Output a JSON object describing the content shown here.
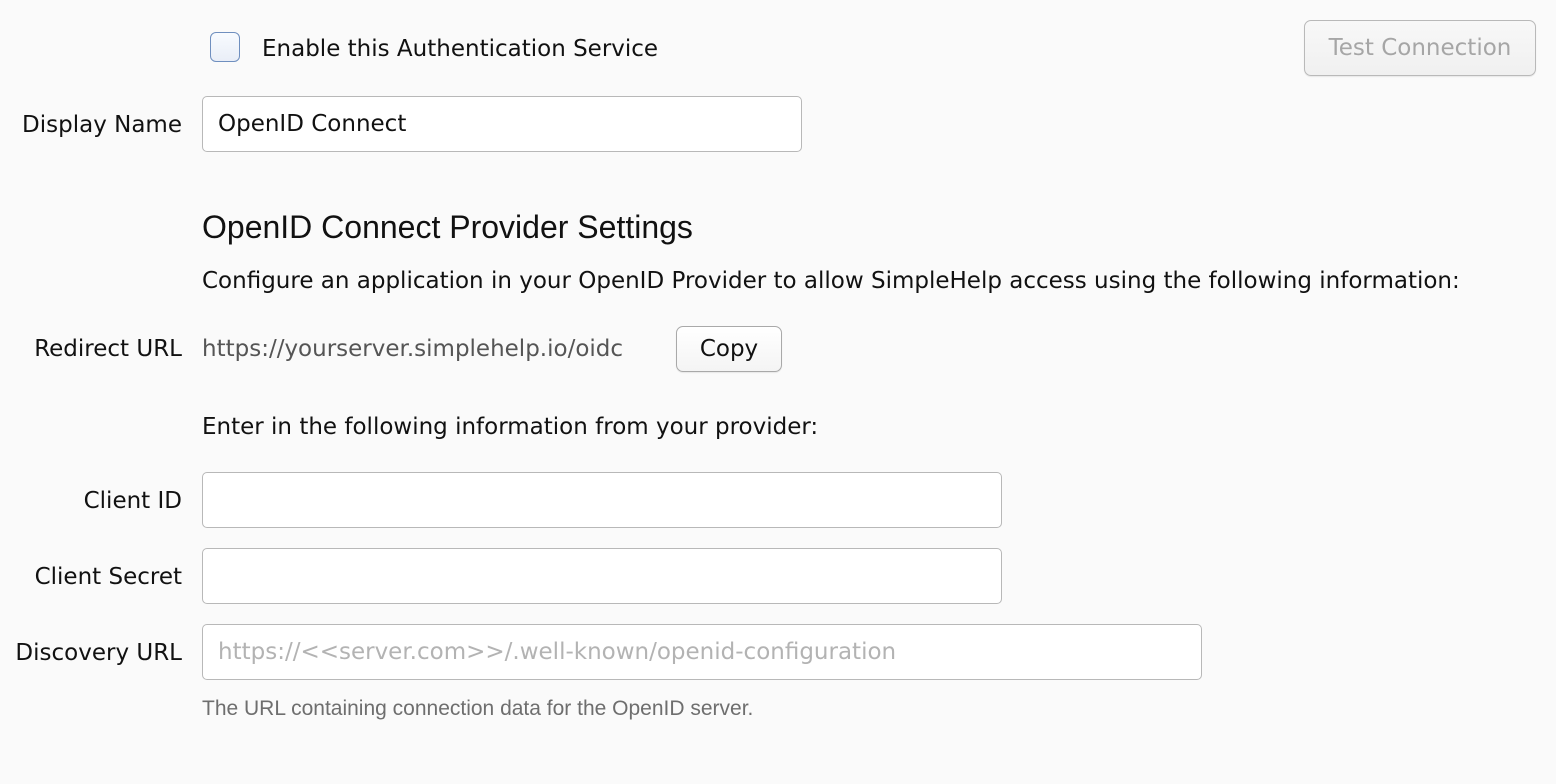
{
  "enable_service": {
    "label": "Enable this Authentication Service",
    "checked": false
  },
  "toolbar": {
    "test_connection_label": "Test Connection",
    "test_connection_enabled": false
  },
  "display_name": {
    "label": "Display Name",
    "value": "OpenID Connect"
  },
  "provider_settings": {
    "title": "OpenID Connect Provider Settings",
    "description": "Configure an application in your OpenID Provider to allow SimpleHelp access using the following information:",
    "redirect_url_label": "Redirect URL",
    "redirect_url_value": "https://yourserver.simplehelp.io/oidc",
    "copy_label": "Copy",
    "enter_info_text": "Enter in the following information from your provider:"
  },
  "client_id": {
    "label": "Client ID",
    "value": ""
  },
  "client_secret": {
    "label": "Client Secret",
    "value": ""
  },
  "discovery_url": {
    "label": "Discovery URL",
    "value": "",
    "placeholder": "https://<<server.com>>/.well-known/openid-configuration",
    "hint": "The URL containing connection data for the OpenID server."
  }
}
